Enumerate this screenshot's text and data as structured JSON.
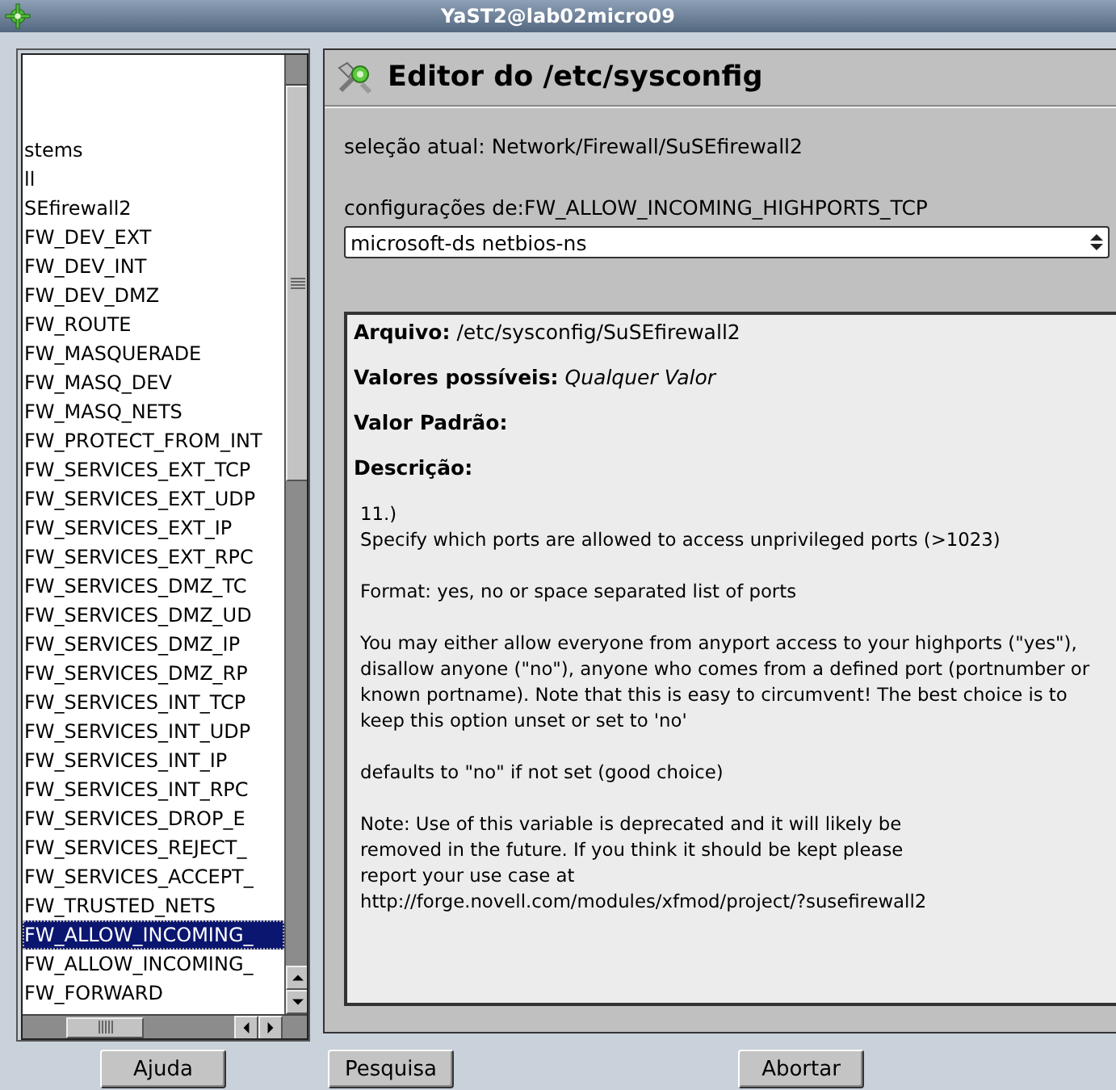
{
  "window": {
    "title": "YaST2@lab02micro09"
  },
  "tree_items": [
    {
      "label": "stems",
      "selected": false
    },
    {
      "label": "ll",
      "selected": false
    },
    {
      "label": "SEfirewall2",
      "selected": false
    },
    {
      "label": "FW_DEV_EXT",
      "selected": false
    },
    {
      "label": "FW_DEV_INT",
      "selected": false
    },
    {
      "label": "FW_DEV_DMZ",
      "selected": false
    },
    {
      "label": "FW_ROUTE",
      "selected": false
    },
    {
      "label": "FW_MASQUERADE",
      "selected": false
    },
    {
      "label": "FW_MASQ_DEV",
      "selected": false
    },
    {
      "label": "FW_MASQ_NETS",
      "selected": false
    },
    {
      "label": "FW_PROTECT_FROM_INT",
      "selected": false
    },
    {
      "label": "FW_SERVICES_EXT_TCP",
      "selected": false
    },
    {
      "label": "FW_SERVICES_EXT_UDP",
      "selected": false
    },
    {
      "label": "FW_SERVICES_EXT_IP",
      "selected": false
    },
    {
      "label": "FW_SERVICES_EXT_RPC",
      "selected": false
    },
    {
      "label": "FW_SERVICES_DMZ_TC",
      "selected": false
    },
    {
      "label": "FW_SERVICES_DMZ_UD",
      "selected": false
    },
    {
      "label": "FW_SERVICES_DMZ_IP",
      "selected": false
    },
    {
      "label": "FW_SERVICES_DMZ_RP",
      "selected": false
    },
    {
      "label": "FW_SERVICES_INT_TCP",
      "selected": false
    },
    {
      "label": "FW_SERVICES_INT_UDP",
      "selected": false
    },
    {
      "label": "FW_SERVICES_INT_IP",
      "selected": false
    },
    {
      "label": "FW_SERVICES_INT_RPC",
      "selected": false
    },
    {
      "label": "FW_SERVICES_DROP_E",
      "selected": false
    },
    {
      "label": "FW_SERVICES_REJECT_",
      "selected": false
    },
    {
      "label": "FW_SERVICES_ACCEPT_",
      "selected": false
    },
    {
      "label": "FW_TRUSTED_NETS",
      "selected": false
    },
    {
      "label": "FW_ALLOW_INCOMING_",
      "selected": true
    },
    {
      "label": "FW_ALLOW_INCOMING_",
      "selected": false
    },
    {
      "label": "FW_FORWARD",
      "selected": false
    }
  ],
  "editor": {
    "title": "Editor do /etc/sysconfig",
    "current_selection": "seleção atual: Network/Firewall/SuSEfirewall2",
    "setting_label": "configurações de:FW_ALLOW_INCOMING_HIGHPORTS_TCP",
    "setting_value": "microsoft-ds netbios-ns",
    "info": [
      {
        "kind": "field",
        "text": "**Arquivo:** /etc/sysconfig/SuSEfirewall2"
      },
      {
        "kind": "field",
        "text": "**Valores possíveis:** *Qualquer Valor*"
      },
      {
        "kind": "heading",
        "text": "Valor Padrão:"
      },
      {
        "kind": "heading",
        "text": "Descrição:"
      },
      {
        "kind": "paragraph",
        "text": "11.)\nSpecify which ports are allowed to access unprivileged ports (>1023)"
      },
      {
        "kind": "paragraph",
        "text": "Format: yes, no or space separated list of ports"
      },
      {
        "kind": "paragraph",
        "text": "You may either allow everyone from anyport access to your highports (\"yes\"),\ndisallow anyone (\"no\"), anyone who comes from a defined port (portnumber or\nknown portname). Note that this is easy to circumvent! The best choice is to\nkeep this option unset or set to 'no'"
      },
      {
        "kind": "paragraph",
        "text": "defaults to \"no\" if not set (good choice)"
      },
      {
        "kind": "paragraph",
        "text": "Note: Use of this variable is deprecated and it will likely be\nremoved in the future. If you think it should be kept please\nreport your use case at\nhttp://forge.novell.com/modules/xfmod/project/?susefirewall2"
      }
    ]
  },
  "buttons": [
    "Ajuda",
    "Pesquisa",
    "Abortar"
  ]
}
